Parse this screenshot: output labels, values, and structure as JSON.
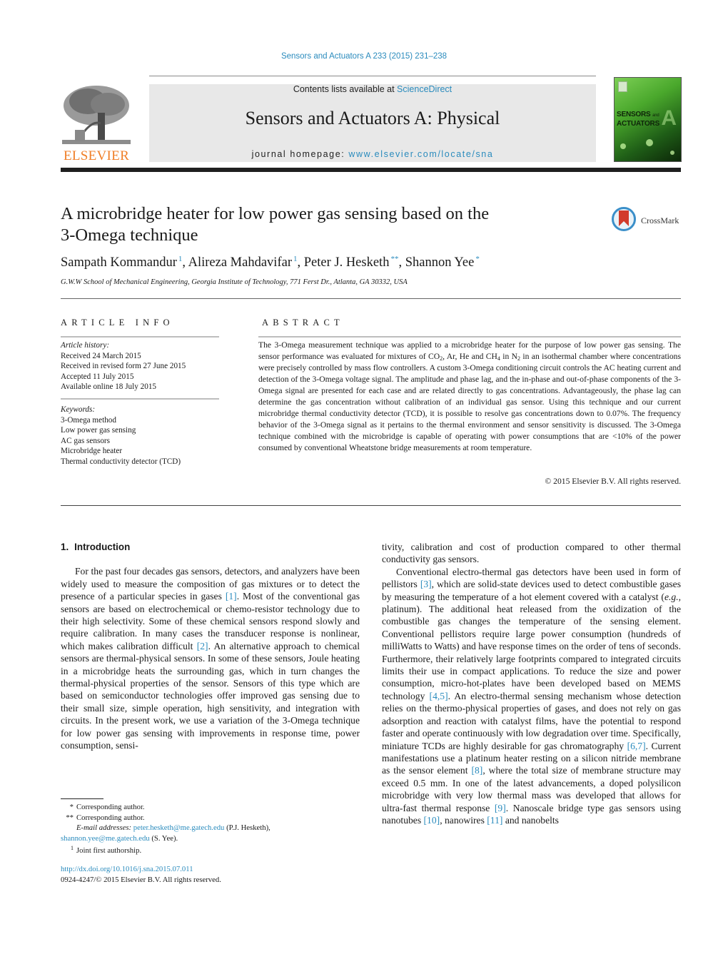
{
  "header": {
    "journal_ref": "Sensors and Actuators A 233 (2015) 231–238",
    "contents_prefix": "Contents lists available at ",
    "contents_link": "ScienceDirect",
    "journal_title": "Sensors and Actuators A: Physical",
    "homepage_prefix": "journal homepage: ",
    "homepage_link": "www.elsevier.com/locate/sna",
    "publisher_logo_text": "ELSEVIER",
    "cover_title_line1": "SENSORS",
    "cover_title_and": "and",
    "cover_title_line2": "ACTUATORS",
    "cover_letter": "A",
    "crossmark_label": "CrossMark"
  },
  "article": {
    "title_line1": "A microbridge heater for low power gas sensing based on the",
    "title_line2": "3-Omega technique",
    "authors": [
      {
        "name": "Sampath Kommandur",
        "mark": "1"
      },
      {
        "name": "Alireza Mahdavifar",
        "mark": "1"
      },
      {
        "name": "Peter J. Hesketh",
        "mark": "**"
      },
      {
        "name": "Shannon Yee",
        "mark": "*"
      }
    ],
    "affiliation": "G.W.W School of Mechanical Engineering, Georgia Institute of Technology, 771 Ferst Dr., Atlanta, GA 30332, USA"
  },
  "article_info": {
    "heading": "ARTICLE INFO",
    "history_label": "Article history:",
    "history": [
      "Received 24 March 2015",
      "Received in revised form 27 June 2015",
      "Accepted 11 July 2015",
      "Available online 18 July 2015"
    ],
    "keywords_label": "Keywords:",
    "keywords": [
      "3-Omega method",
      "Low power gas sensing",
      "AC gas sensors",
      "Microbridge heater",
      "Thermal conductivity detector (TCD)"
    ]
  },
  "abstract": {
    "heading": "ABSTRACT",
    "text_1": "The 3-Omega measurement technique was applied to a microbridge heater for the purpose of low power gas sensing. The sensor performance was evaluated for mixtures of CO",
    "sub_1": "2",
    "text_2": ", Ar, He and CH",
    "sub_2": "4",
    "text_3": " in N",
    "sub_3": "2",
    "text_4": " in an isothermal chamber where concentrations were precisely controlled by mass flow controllers. A custom 3-Omega conditioning circuit controls the AC heating current and detection of the 3-Omega voltage signal. The amplitude and phase lag, and the in-phase and out-of-phase components of the 3-Omega signal are presented for each case and are related directly to gas concentrations. Advantageously, the phase lag can determine the gas concentration without calibration of an individual gas sensor. Using this technique and our current microbridge thermal conductivity detector (TCD), it is possible to resolve gas concentrations down to 0.07%. The frequency behavior of the 3-Omega signal as it pertains to the thermal environment and sensor sensitivity is discussed. The 3-Omega technique combined with the microbridge is capable of operating with power consumptions that are <10% of the power consumed by conventional Wheatstone bridge measurements at room temperature.",
    "copyright": "© 2015 Elsevier B.V. All rights reserved."
  },
  "body": {
    "section_number": "1.",
    "section_title": "Introduction",
    "p1": [
      {
        "t": "For the past four decades gas sensors, detectors, and analyzers have been widely used to measure the composition of gas mixtures or to detect the presence of a particular species in gases "
      },
      {
        "c": "[1]"
      },
      {
        "t": ". Most of the conventional gas sensors are based on electrochemical or chemo-resistor technology due to their high selectivity. Some of these chemical sensors respond slowly and require calibration. In many cases the transducer response is nonlinear, which makes calibration difficult "
      },
      {
        "c": "[2]"
      },
      {
        "t": ". An alternative approach to chemical sensors are thermal-physical sensors. In some of these sensors, Joule heating in a microbridge heats the surrounding gas, which in turn changes the thermal-physical properties of the sensor. Sensors of this type which are based on semiconductor technologies offer improved gas sensing due to their small size, simple operation, high sensitivity, and integration with circuits. In the present work, we use a variation of the 3-Omega technique for low power gas sensing with improvements in response time, power consumption, sensi-"
      }
    ],
    "p1_cont": "tivity, calibration and cost of production compared to other thermal conductivity gas sensors.",
    "p2": [
      {
        "t": "Conventional electro-thermal gas detectors have been used in form of pellistors "
      },
      {
        "c": "[3]"
      },
      {
        "t": ", which are solid-state devices used to detect combustible gases by measuring the temperature of a hot element covered with a catalyst ("
      },
      {
        "i": "e.g.,"
      },
      {
        "t": " platinum). The additional heat released from the oxidization of the combustible gas changes the temperature of the sensing element. Conventional pellistors require large power consumption (hundreds of milliWatts to Watts) and have response times on the order of tens of seconds. Furthermore, their relatively large footprints compared to integrated circuits limits their use in compact applications. To reduce the size and power consumption, micro-hot-plates have been developed based on MEMS technology "
      },
      {
        "c": "[4,5]"
      },
      {
        "t": ". An electro-thermal sensing mechanism whose detection relies on the thermo-physical properties of gases, and does not rely on gas adsorption and reaction with catalyst films, have the potential to respond faster and operate continuously with low degradation over time. Specifically, miniature TCDs are highly desirable for gas chromatography "
      },
      {
        "c": "[6,7]"
      },
      {
        "t": ". Current manifestations use a platinum heater resting on a silicon nitride membrane as the sensor element "
      },
      {
        "c": "[8]"
      },
      {
        "t": ", where the total size of membrane structure may exceed 0.5 mm. In one of the latest advancements, a doped polysilicon microbridge with very low thermal mass was developed that allows for ultra-fast thermal response "
      },
      {
        "c": "[9]"
      },
      {
        "t": ". Nanoscale bridge type gas sensors using nanotubes "
      },
      {
        "c": "[10]"
      },
      {
        "t": ", nanowires "
      },
      {
        "c": "[11]"
      },
      {
        "t": " and nanobelts"
      }
    ]
  },
  "footnotes": {
    "star_mark": "*",
    "star_text": "Corresponding author.",
    "dstar_mark": "**",
    "dstar_text": "Corresponding author.",
    "email_label": "E-mail addresses:",
    "email1": "peter.hesketh@me.gatech.edu",
    "email1_owner": " (P.J. Hesketh),",
    "email2": "shannon.yee@me.gatech.edu",
    "email2_owner": " (S. Yee).",
    "one_mark": "1",
    "one_text": "Joint first authorship.",
    "doi": "http://dx.doi.org/10.1016/j.sna.2015.07.011",
    "issn_line": "0924-4247/© 2015 Elsevier B.V. All rights reserved."
  }
}
